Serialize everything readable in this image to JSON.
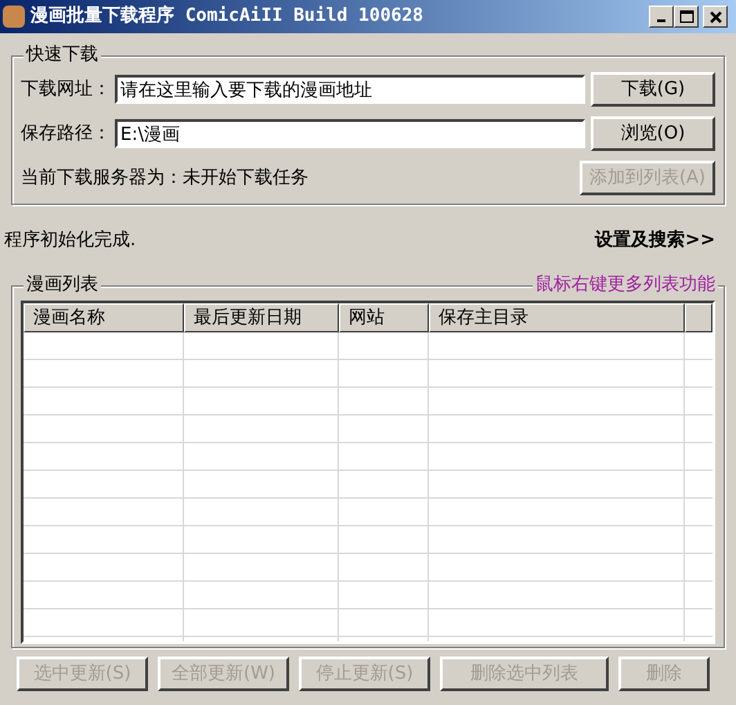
{
  "window": {
    "title": "漫画批量下载程序 ComicAiII Build 100628"
  },
  "quick_download": {
    "title": "快速下载",
    "url": {
      "label": "下载网址：",
      "value": "请在这里输入要下载的漫画地址"
    },
    "path": {
      "label": "保存路径：",
      "value": "E:\\漫画"
    },
    "server": "当前下载服务器为：未开始下载任务",
    "buttons": [
      {
        "label": "下载(G)",
        "disabled": false
      },
      {
        "label": "浏览(O)",
        "disabled": false
      },
      {
        "label": "添加到列表(A)",
        "disabled": true
      }
    ]
  },
  "status": "程序初始化完成.",
  "settings_link": "设置及搜索>>",
  "comic_list": {
    "title": "漫画列表",
    "hint": "鼠标右键更多列表功能",
    "columns": [
      "漫画名称",
      "最后更新日期",
      "网站",
      "保存主目录"
    ]
  },
  "bottom_buttons": [
    {
      "label": "选中更新(S)",
      "disabled": true
    },
    {
      "label": "全部更新(W)",
      "disabled": true
    },
    {
      "label": "停止更新(S)",
      "disabled": true
    },
    {
      "label": "删除选中列表",
      "disabled": true
    },
    {
      "label": "删除",
      "disabled": true
    }
  ]
}
